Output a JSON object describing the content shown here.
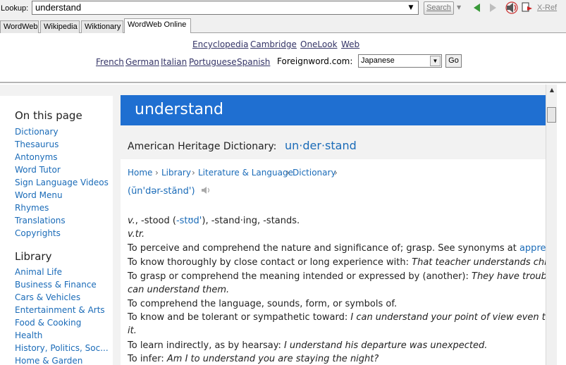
{
  "lookup": {
    "label": "Lookup:",
    "value": "understand",
    "search_label": "Search",
    "xref_label": "X-Ref"
  },
  "tabs": [
    {
      "label": "WordWeb"
    },
    {
      "label": "Wikipedia"
    },
    {
      "label": "Wiktionary"
    },
    {
      "label": "WordWeb Online"
    }
  ],
  "links": {
    "row1": [
      "Encyclopedia",
      "Cambridge",
      "OneLook",
      "Web"
    ],
    "row2": [
      "French",
      "German",
      "Italian",
      "Portuguese",
      "Spanish"
    ],
    "foreignword_label": "Foreignword.com:",
    "language_selected": "Japanese",
    "go_label": "Go"
  },
  "sidebar": {
    "on_this_page_heading": "On this page",
    "on_this_page": [
      "Dictionary",
      "Thesaurus",
      "Antonyms",
      "Word Tutor",
      "Sign Language Videos",
      "Word Menu",
      "Rhymes",
      "Translations",
      "Copyrights"
    ],
    "library_heading": "Library",
    "library": [
      "Animal Life",
      "Business & Finance",
      "Cars & Vehicles",
      "Entertainment & Arts",
      "Food & Cooking",
      "Health",
      "History, Politics, Soc...",
      "Home & Garden"
    ]
  },
  "entry": {
    "word": "understand",
    "source_label": "American Heritage Dictionary:",
    "syllables": "un·der·stand",
    "breadcrumbs": [
      "Home",
      "Library",
      "Literature & Language",
      "Dictionary"
    ],
    "pronunciation": "(ŭn'dər-stănd')",
    "inflection_pos": "v.",
    "inflection_stood": ", -stood (",
    "inflection_stood_pron": "-stʊd'",
    "inflection_rest": "), -stand·ing, -stands.",
    "sense_label": "v.tr.",
    "definitions": [
      {
        "text": "To perceive and comprehend the nature and significance of; grasp. See synonyms at ",
        "link": "apprehend",
        "example": ""
      },
      {
        "text": "To know thoroughly by close contact or long experience with: ",
        "link": "",
        "example": "That teacher understands children"
      },
      {
        "text": "To grasp or comprehend the meaning intended or expressed by (another): ",
        "link": "",
        "example": "They have trouble w"
      },
      {
        "text": "",
        "link": "",
        "example": "can understand them."
      },
      {
        "text": "To comprehend the language, sounds, form, or symbols of.",
        "link": "",
        "example": ""
      },
      {
        "text": "To know and be tolerant or sympathetic toward: ",
        "link": "",
        "example": "I can understand your point of view even thoug"
      },
      {
        "text": "",
        "link": "",
        "example": "it."
      },
      {
        "text": "To learn indirectly, as by hearsay: ",
        "link": "",
        "example": "I understand his departure was unexpected."
      },
      {
        "text": "To infer: ",
        "link": "",
        "example": "Am I to understand you are staying the night?"
      }
    ]
  }
}
